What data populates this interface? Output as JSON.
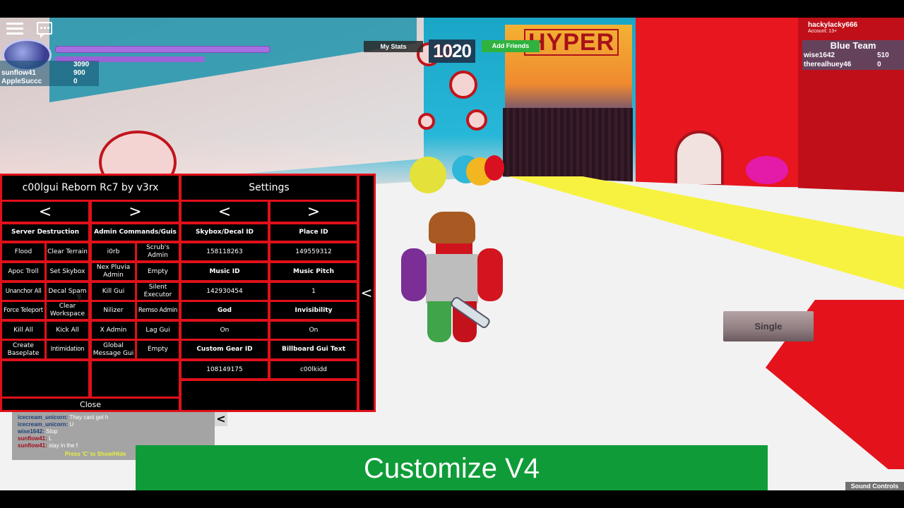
{
  "topbar": {
    "menu_icon": "hamburger-menu-icon",
    "chat_icon": "chat-bubble-icon",
    "my_stats_label": "My Stats",
    "add_friends_label": "Add Friends",
    "timer": {
      "left": "10",
      "right": "20"
    }
  },
  "account": {
    "username": "hackylacky666",
    "age_label": "Account: 13+"
  },
  "leaderboard_left": [
    {
      "name": "",
      "score": "3090"
    },
    {
      "name": "sunflow41",
      "score": "900"
    },
    {
      "name": "AppleSuccc",
      "score": "0"
    }
  ],
  "team": {
    "name": "Blue Team",
    "color": "#1f6f9a",
    "players": [
      {
        "name": "wise1642",
        "score": "510"
      },
      {
        "name": "therealhuey46",
        "score": "0"
      }
    ]
  },
  "scene": {
    "sign_text": "HYPER"
  },
  "gui": {
    "title": "c00lgui Reborn Rc7 by v3rx",
    "settings_title": "Settings",
    "prev_label": "<",
    "next_label": ">",
    "collapse_label": "<",
    "close_label": "Close",
    "accent_color": "#e0101a",
    "columns": [
      {
        "header": "Server Destruction",
        "buttons": [
          [
            "Flood",
            "Clear Terrain"
          ],
          [
            "Apoc Troll",
            "Set Skybox"
          ],
          [
            "Unanchor All",
            "Decal Spam"
          ],
          [
            "Force Teleport",
            "Clear Workspace"
          ],
          [
            "Kill All",
            "Kick All"
          ],
          [
            "Create Baseplate",
            "Intimidation"
          ]
        ]
      },
      {
        "header": "Admin Commands/Guis",
        "buttons": [
          [
            "i0rb",
            "Scrub's Admin"
          ],
          [
            "Nex Pluvia Admin",
            "Empty"
          ],
          [
            "Kill Gui",
            "Silent Executor"
          ],
          [
            "Nilizer",
            "Remso Admin"
          ],
          [
            "X Admin",
            "Lag Gui"
          ],
          [
            "Global Message Gui",
            "Empty"
          ]
        ]
      }
    ],
    "settings": [
      {
        "label": "Skybox/Decal ID",
        "value": "158118263"
      },
      {
        "label": "Place ID",
        "value": "149559312"
      },
      {
        "label": "Music ID",
        "value": "142930454"
      },
      {
        "label": "Music Pitch",
        "value": "1"
      },
      {
        "label": "God",
        "value": "On"
      },
      {
        "label": "Invisibility",
        "value": "On"
      },
      {
        "label": "Custom Gear ID",
        "value": "108149175"
      },
      {
        "label": "Billboard Gui Text",
        "value": "c00lkidd"
      }
    ]
  },
  "chat": {
    "messages": [
      {
        "who": "icecream_unicorn:",
        "text": "Thay cant get h",
        "color": "#1d3f7a"
      },
      {
        "who": "icecream_unicorn:",
        "text": "U",
        "color": "#1d3f7a"
      },
      {
        "who": "wise1642:",
        "text": "Stop",
        "color": "#1d3f7a"
      },
      {
        "who": "sunflow41:",
        "text": "L",
        "color": "#a01020"
      },
      {
        "who": "sunflow41:",
        "text": "stay in the f",
        "color": "#a01020"
      }
    ],
    "hint": "Press 'C' to Show/Hide",
    "toggle_label": "<"
  },
  "single_button_label": "Single",
  "banner_text": "Customize V4",
  "sound_controls_label": "Sound Controls"
}
